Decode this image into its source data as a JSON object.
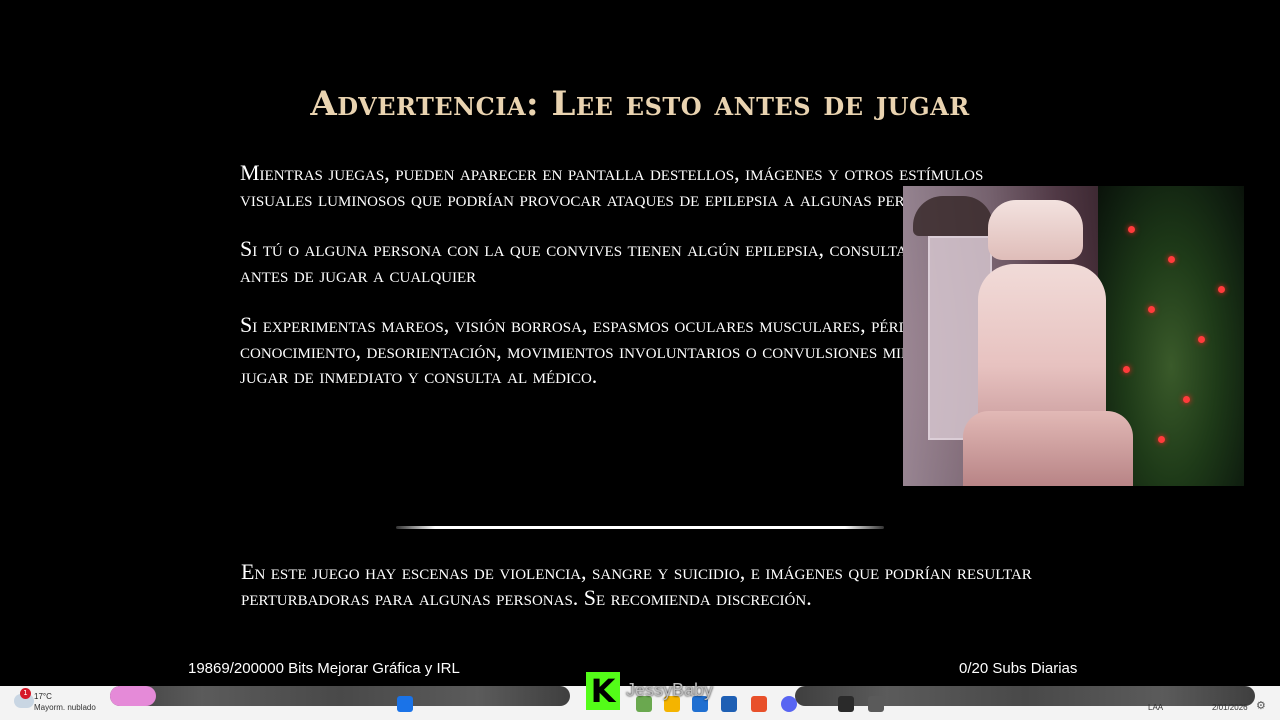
{
  "warning": {
    "title": "Advertencia: Lee esto antes de jugar",
    "paragraphs": [
      "Mientras juegas, pueden aparecer en pantalla destellos, imágenes y otros estímulos visuales luminosos que podrían provocar ataques de epilepsia a algunas personas.",
      "Si tú o alguna persona con la que convives tienen algún epilepsia, consulta al médico antes de jugar a cualquier",
      "Si experimentas mareos, visión borrosa, espasmos oculares musculares, pérdidas de conocimiento, desorientación, movimientos involuntarios o convulsiones mientras ju de jugar de inmediato y consulta al médico."
    ],
    "content_notice": "En este juego hay escenas de violencia, sangre y suicidio, e imágenes que podrían resultar perturbadoras para algunas personas. Se recomienda discreción."
  },
  "stream": {
    "bits_goal": "19869/200000 Bits Mejorar Gráfica y IRL",
    "subs_goal": "0/20 Subs Diarias",
    "channel_name": "JessyBaby",
    "kick_logo": "K"
  },
  "taskbar": {
    "weather_temp": "17°C",
    "weather_desc": "Mayorm. nublado",
    "notification_count": "1",
    "lang": "LAA",
    "date": "2/01/2026",
    "settings_icon": "gear-icon"
  },
  "colors": {
    "title": "#e9d3b0",
    "body_text": "#ffffff",
    "kick_green": "#53fc18"
  }
}
